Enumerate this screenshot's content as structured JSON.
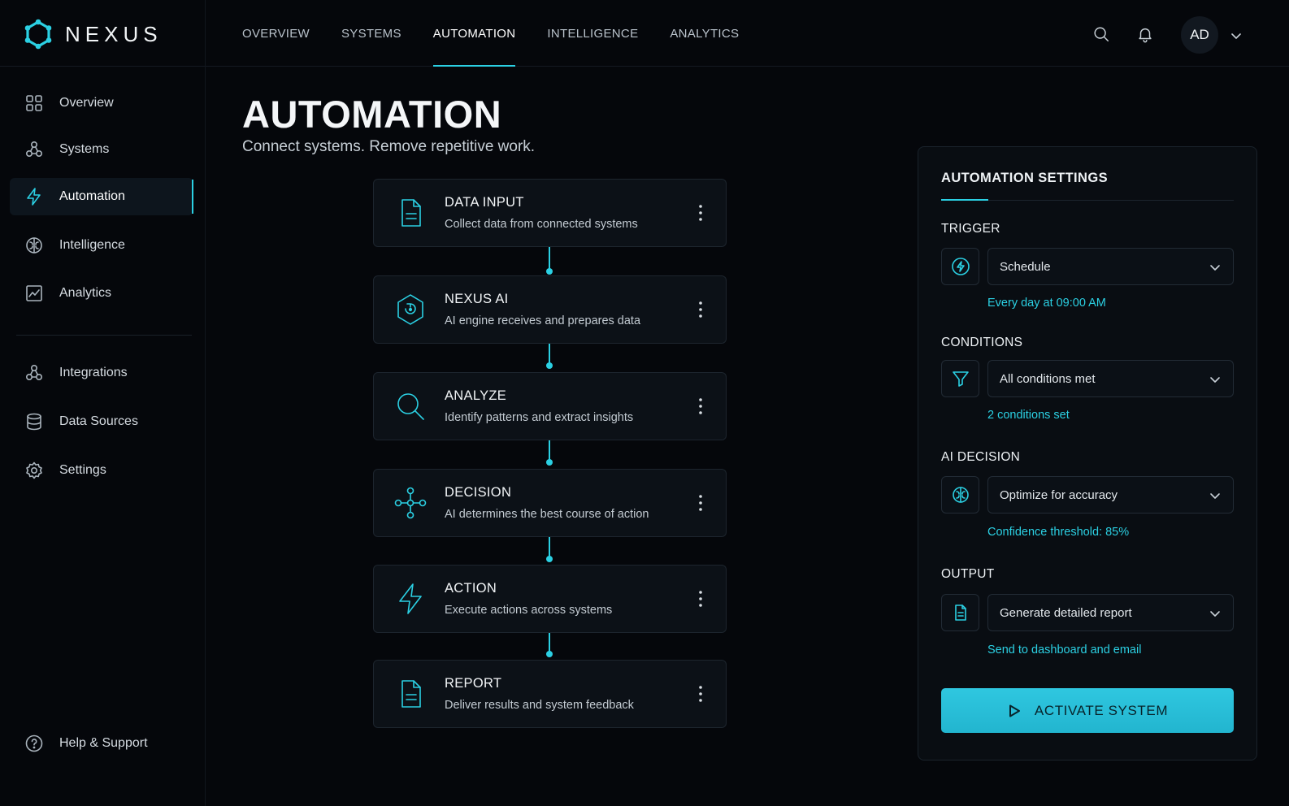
{
  "brand": {
    "name": "NEXUS",
    "logo_icon": "hex-ring-logo-icon"
  },
  "topnav": {
    "items": [
      {
        "label": "OVERVIEW",
        "active": false
      },
      {
        "label": "SYSTEMS",
        "active": false
      },
      {
        "label": "AUTOMATION",
        "active": true
      },
      {
        "label": "INTELLIGENCE",
        "active": false
      },
      {
        "label": "ANALYTICS",
        "active": false
      }
    ],
    "user_initials": "AD",
    "icons": [
      "search-icon",
      "bell-icon",
      "chevron-down-icon"
    ]
  },
  "sidebar": {
    "items": [
      {
        "label": "Overview",
        "icon": "grid-icon",
        "active": false
      },
      {
        "label": "Systems",
        "icon": "nodes-icon",
        "active": false
      },
      {
        "label": "Automation",
        "icon": "bolt-icon",
        "active": true
      },
      {
        "label": "Intelligence",
        "icon": "brain-icon",
        "active": false
      },
      {
        "label": "Analytics",
        "icon": "chart-icon",
        "active": false
      },
      {
        "label": "Integrations",
        "icon": "nodes-icon",
        "active": false
      },
      {
        "label": "Data Sources",
        "icon": "database-icon",
        "active": false
      },
      {
        "label": "Settings",
        "icon": "gear-icon",
        "active": false
      }
    ],
    "help_label": "Help & Support"
  },
  "page": {
    "title": "AUTOMATION",
    "subtitle": "Connect systems. Remove repetitive work."
  },
  "flow": {
    "steps": [
      {
        "title": "DATA INPUT",
        "description": "Collect data from connected systems",
        "icon": "document-icon"
      },
      {
        "title": "NEXUS AI",
        "description": "AI engine receives and prepares data",
        "icon": "hex-ai-icon"
      },
      {
        "title": "ANALYZE",
        "description": "Identify patterns and extract insights",
        "icon": "search-icon"
      },
      {
        "title": "DECISION",
        "description": "AI determines the best course of action",
        "icon": "branch-icon"
      },
      {
        "title": "ACTION",
        "description": "Execute actions across systems",
        "icon": "bolt-icon"
      },
      {
        "title": "REPORT",
        "description": "Deliver results and system feedback",
        "icon": "document-icon"
      }
    ]
  },
  "settings": {
    "title": "AUTOMATION SETTINGS",
    "trigger": {
      "label": "TRIGGER",
      "value": "Schedule",
      "hint": "Every day at 09:00 AM",
      "icon": "bolt-circle-icon"
    },
    "conditions": {
      "label": "CONDITIONS",
      "value": "All conditions met",
      "hint": "2 conditions set",
      "icon": "filter-icon"
    },
    "ai_decision": {
      "label": "AI DECISION",
      "value": "Optimize for accuracy",
      "hint": "Confidence threshold: 85%",
      "icon": "brain-icon"
    },
    "output": {
      "label": "OUTPUT",
      "value": "Generate detailed report",
      "hint": "Send to dashboard and email",
      "icon": "document-icon"
    },
    "activate_label": "ACTIVATE SYSTEM"
  },
  "colors": {
    "accent": "#2bd0e3",
    "background": "#05070b",
    "card": "#0c1117"
  }
}
